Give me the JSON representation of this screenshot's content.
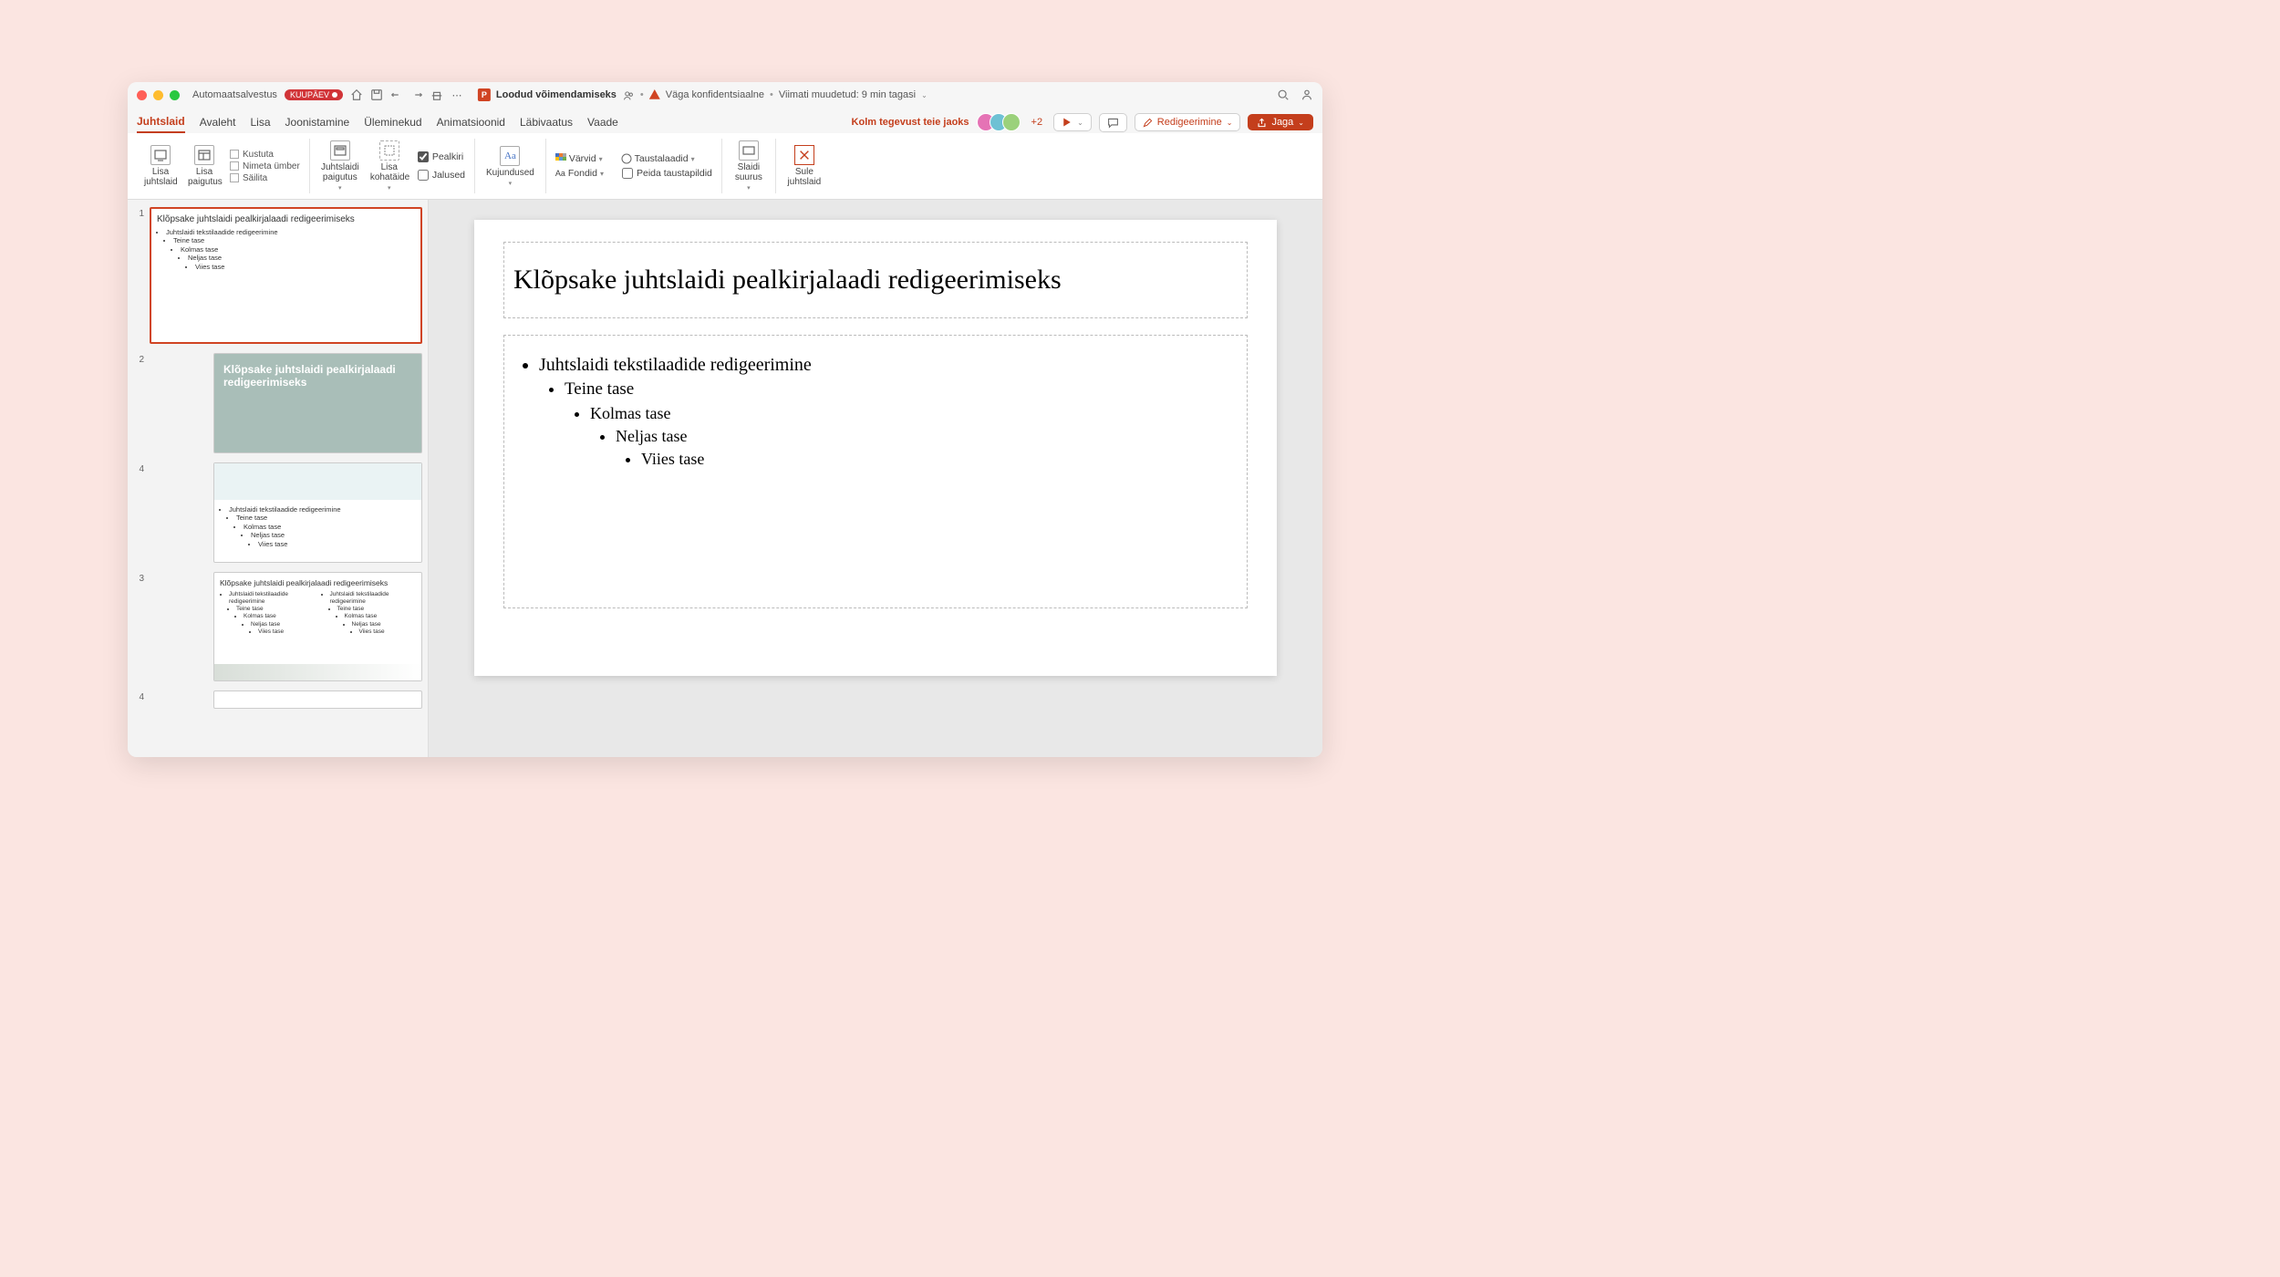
{
  "titlebar": {
    "autosave": "Automaatsalvestus",
    "autosave_badge": "KUUPÄEV",
    "doc_title": "Loodud võimendamiseks",
    "sensitivity": "Väga konfidentsiaalne",
    "modified": "Viimati muudetud: 9 min tagasi"
  },
  "tabs": {
    "items": [
      "Juhtslaid",
      "Avaleht",
      "Lisa",
      "Joonistamine",
      "Üleminekud",
      "Animatsioonid",
      "Läbivaatus",
      "Vaade"
    ],
    "active_index": 0,
    "activity": "Kolm tegevust teie jaoks",
    "plus": "+2",
    "edit": "Redigeerimine",
    "share": "Jaga"
  },
  "ribbon": {
    "insert_master": "Lisa juhtslaid",
    "insert_layout": "Lisa paigutus",
    "delete": "Kustuta",
    "rename": "Nimeta ümber",
    "preserve": "Säilita",
    "master_layout": "Juhtslaidi paigutus",
    "insert_placeholder": "Lisa kohatäide",
    "chk_title": "Pealkiri",
    "chk_footers": "Jalused",
    "themes": "Kujundused",
    "colors": "Värvid",
    "fonts": "Fondid",
    "bg_styles": "Taustalaadid",
    "hide_bg": "Peida taustapildid",
    "slide_size": "Slaidi suurus",
    "close_master": "Sule juhtslaid"
  },
  "thumbs": {
    "master": {
      "n": "1",
      "title": "Klõpsake juhtslaidi pealkirjalaadi redigeerimiseks",
      "l1": "Juhtslaidi tekstilaadide redigeerimine",
      "l2": "Teine tase",
      "l3": "Kolmas tase",
      "l4": "Neljas tase",
      "l5": "Viies tase"
    },
    "t2": {
      "n": "2",
      "title": "Klõpsake juhtslaidi pealkirjalaadi redigeerimiseks"
    },
    "t4a": {
      "n": "4",
      "l1": "Juhtslaidi tekstilaadide redigeerimine",
      "l2": "Teine tase",
      "l3": "Kolmas tase",
      "l4": "Neljas tase",
      "l5": "Viies tase"
    },
    "t3": {
      "n": "3",
      "title": "Klõpsake juhtslaidi pealkirjalaadi redigeerimiseks",
      "l1": "Juhtslaidi tekstilaadide redigeerimine",
      "l2": "Teine tase",
      "l3": "Kolmas tase",
      "l4": "Neljas tase",
      "l5": "Viies tase"
    },
    "t4b": {
      "n": "4"
    }
  },
  "slide": {
    "title": "Klõpsake juhtslaidi pealkirjalaadi redigeerimiseks",
    "l1": "Juhtslaidi tekstilaadide redigeerimine",
    "l2": "Teine tase",
    "l3": "Kolmas tase",
    "l4": "Neljas tase",
    "l5": "Viies tase"
  }
}
